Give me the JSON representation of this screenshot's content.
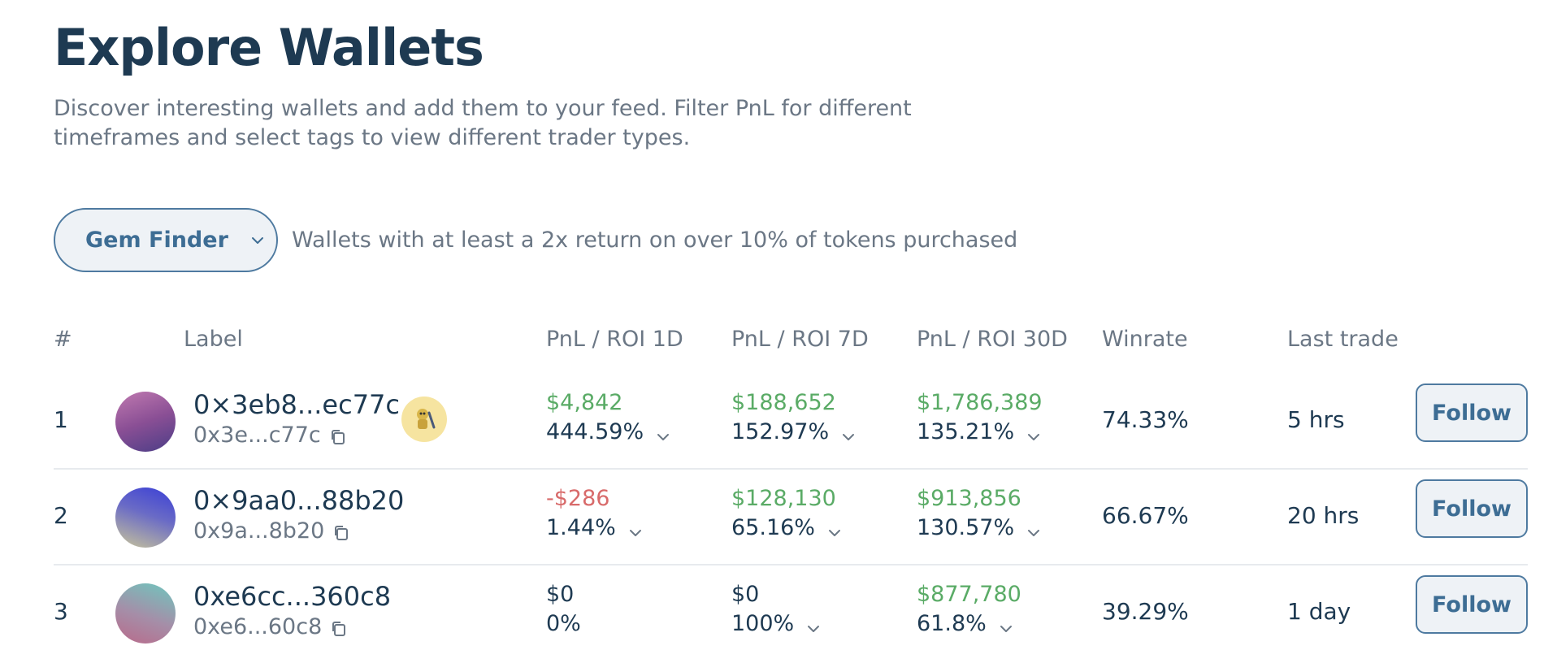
{
  "page": {
    "title": "Explore Wallets",
    "description": "Discover interesting wallets and add them to your feed. Filter PnL for different timeframes and select tags to view different trader types."
  },
  "filter": {
    "selected_tag": "Gem Finder",
    "tag_description": "Wallets with at least a 2x return on over 10% of tokens purchased"
  },
  "table": {
    "headers": {
      "rank": "#",
      "label": "Label",
      "pnl_1d": "PnL / ROI 1D",
      "pnl_7d": "PnL / ROI 7D",
      "pnl_30d": "PnL / ROI 30D",
      "winrate": "Winrate",
      "last_trade": "Last trade"
    },
    "rows": [
      {
        "rank": "1",
        "name": "0×3eb8...ec77c",
        "address": "0x3e...c77c",
        "pnl_1d": "$4,842",
        "roi_1d": "444.59%",
        "pnl_7d": "$188,652",
        "roi_7d": "152.97%",
        "pnl_30d": "$1,786,389",
        "roi_30d": "135.21%",
        "winrate": "74.33%",
        "last_trade": "5 hrs",
        "follow": "Follow"
      },
      {
        "rank": "2",
        "name": "0×9aa0...88b20",
        "address": "0x9a...8b20",
        "pnl_1d": "-$286",
        "roi_1d": "1.44%",
        "pnl_7d": "$128,130",
        "roi_7d": "65.16%",
        "pnl_30d": "$913,856",
        "roi_30d": "130.57%",
        "winrate": "66.67%",
        "last_trade": "20 hrs",
        "follow": "Follow"
      },
      {
        "rank": "3",
        "name": "0xe6cc...360c8",
        "address": "0xe6...60c8",
        "pnl_1d": "$0",
        "roi_1d": "0%",
        "pnl_7d": "$0",
        "roi_7d": "100%",
        "pnl_30d": "$877,780",
        "roi_30d": "61.8%",
        "winrate": "39.29%",
        "last_trade": "1 day",
        "follow": "Follow"
      }
    ]
  },
  "colors": {
    "positive": "#5aab66",
    "negative": "#d86a6a",
    "accent": "#3d6d94",
    "text": "#1e3a52",
    "muted": "#6b7785"
  },
  "icons": {
    "tag_dropdown": "chevron-down-icon",
    "copy": "copy-icon",
    "roi_expand": "chevron-down-icon",
    "badge": "trader-badge-icon"
  }
}
